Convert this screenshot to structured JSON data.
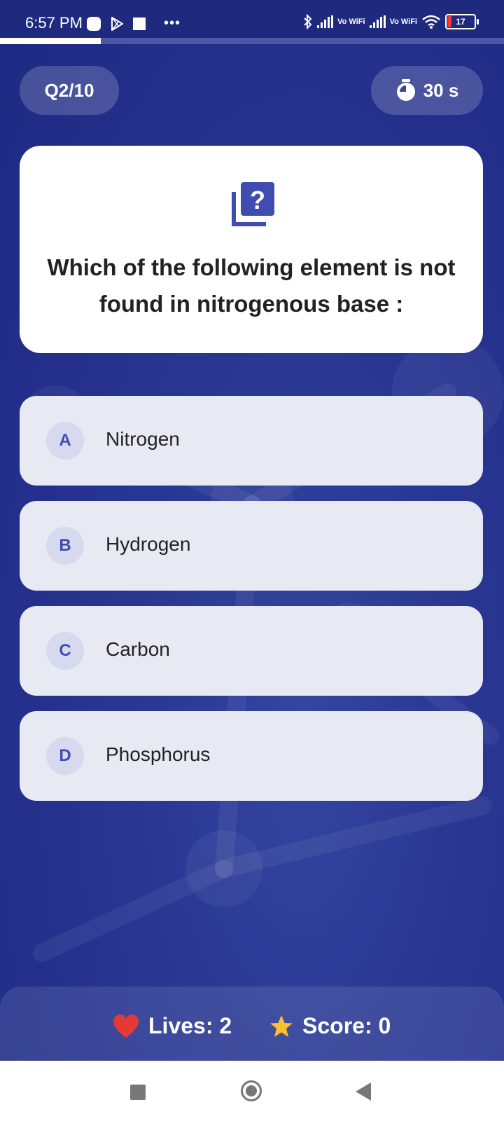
{
  "status_bar": {
    "time": "6:57 PM",
    "network_1": "Vo WiFi",
    "network_2": "Vo WiFi",
    "battery": "17",
    "battery_color": "#ff3030"
  },
  "quiz": {
    "progress": 0.2,
    "question_counter": "Q2/10",
    "timer": "30 s",
    "question_icon": "quiz-icon",
    "question": "Which of the following element is not found in nitrogenous base :",
    "options": [
      {
        "letter": "A",
        "label": "Nitrogen"
      },
      {
        "letter": "B",
        "label": "Hydrogen"
      },
      {
        "letter": "C",
        "label": "Carbon"
      },
      {
        "letter": "D",
        "label": "Phosphorus"
      }
    ]
  },
  "footer": {
    "lives": "Lives: 2",
    "score": "Score: 0",
    "heart_color": "#e53935",
    "star_color": "#fbc02d"
  },
  "theme": {
    "background": "#26338f",
    "accent": "#3f4cb0"
  },
  "nav": [
    "recents-icon",
    "home-icon",
    "back-icon"
  ]
}
